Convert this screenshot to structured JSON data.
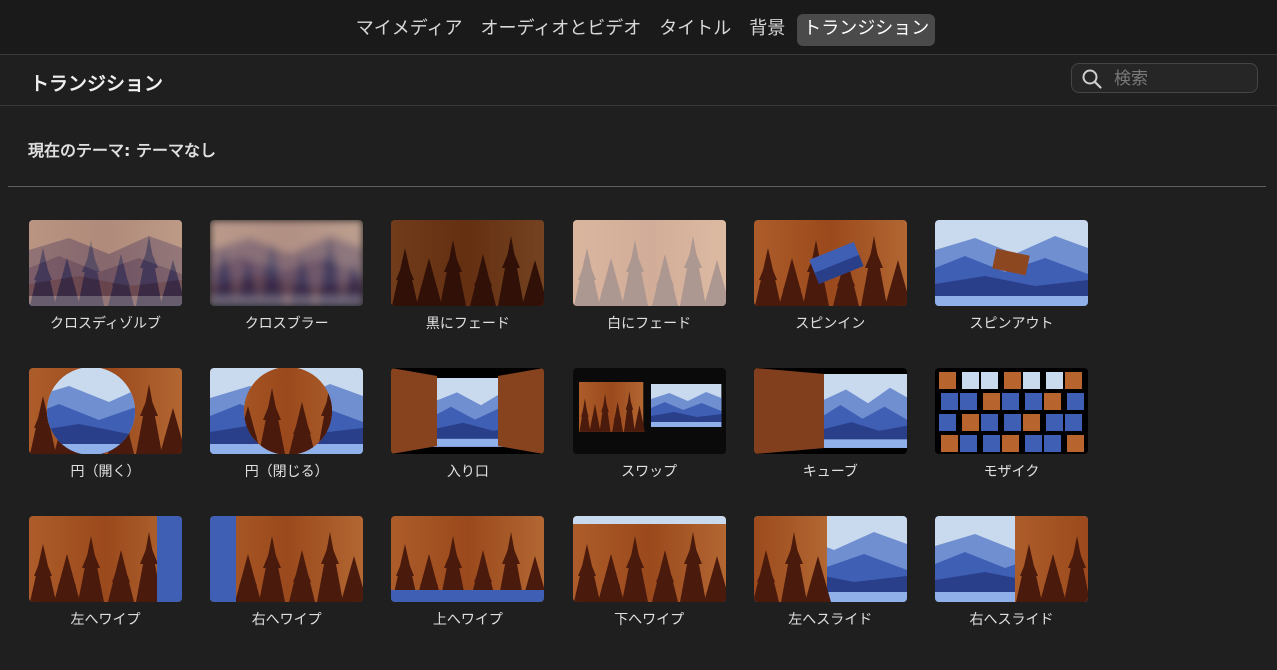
{
  "tabs": [
    {
      "label": "マイメディア",
      "active": false
    },
    {
      "label": "オーディオとビデオ",
      "active": false
    },
    {
      "label": "タイトル",
      "active": false
    },
    {
      "label": "背景",
      "active": false
    },
    {
      "label": "トランジション",
      "active": true
    }
  ],
  "header": {
    "title": "トランジション",
    "search_placeholder": "検索"
  },
  "theme_label": "現在のテーマ: テーマなし",
  "transitions": [
    {
      "name": "クロスディゾルブ",
      "style": "dissolve"
    },
    {
      "name": "クロスブラー",
      "style": "blur"
    },
    {
      "name": "黒にフェード",
      "style": "fade-black"
    },
    {
      "name": "白にフェード",
      "style": "fade-white"
    },
    {
      "name": "スピンイン",
      "style": "spin-in"
    },
    {
      "name": "スピンアウト",
      "style": "spin-out"
    },
    {
      "name": "円（開く）",
      "style": "circle-open"
    },
    {
      "name": "円（閉じる）",
      "style": "circle-close"
    },
    {
      "name": "入り口",
      "style": "doorway"
    },
    {
      "name": "スワップ",
      "style": "swap"
    },
    {
      "name": "キューブ",
      "style": "cube"
    },
    {
      "name": "モザイク",
      "style": "mosaic"
    },
    {
      "name": "左へワイプ",
      "style": "wipe-left"
    },
    {
      "name": "右へワイプ",
      "style": "wipe-right"
    },
    {
      "name": "上へワイプ",
      "style": "wipe-up"
    },
    {
      "name": "下へワイプ",
      "style": "wipe-down"
    },
    {
      "name": "左へスライド",
      "style": "slide-left"
    },
    {
      "name": "右へスライド",
      "style": "slide-right"
    }
  ],
  "colors": {
    "forest_bg": "#b8642e",
    "forest_dark": "#5a2410",
    "tree": "#4a1a0c",
    "sky": "#c9d9ee",
    "mountain_far": "#6f8fd0",
    "mountain_mid": "#3f5fb5",
    "mountain_near": "#2a3f8a",
    "water": "#8fb0e8"
  }
}
